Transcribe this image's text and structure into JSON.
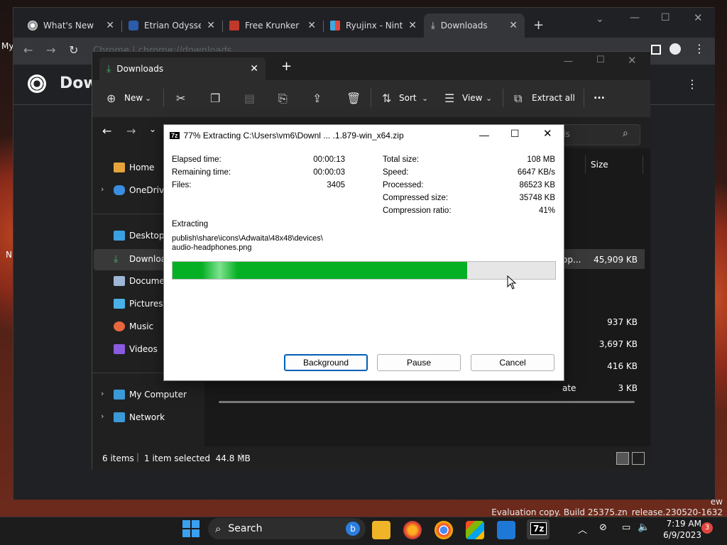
{
  "desktop": {
    "top_glyph": "My",
    "side_glyph_a": "N",
    "eval_line1": "ew",
    "eval_line2": "Evaluation copy. Build 25375.zn_release.230520-1632"
  },
  "chrome": {
    "tabs": [
      {
        "label": "What's New",
        "icon": "chrome-icon"
      },
      {
        "label": "Etrian Odyssey",
        "icon": "site-icon"
      },
      {
        "label": "Free Krunker A",
        "icon": "site-icon"
      },
      {
        "label": "Ryujinx - Ninte",
        "icon": "site-icon"
      },
      {
        "label": "Downloads",
        "icon": "download-icon"
      }
    ],
    "new_tab": "+",
    "omnibox_text": "Chrome | chrome://downloads",
    "page_title": "Downl"
  },
  "explorer": {
    "tab_label": "Downloads",
    "toolbar": {
      "new": "New",
      "sort": "Sort",
      "view": "View",
      "extract_all": "Extract all",
      "more": "..."
    },
    "search_placeholder": "ds",
    "column_size": "Size",
    "sidebar": [
      {
        "label": "Home"
      },
      {
        "label": "OneDrive"
      },
      {
        "label": "Desktop"
      },
      {
        "label": "Downloads"
      },
      {
        "label": "Documents"
      },
      {
        "label": "Pictures"
      },
      {
        "label": "Music"
      },
      {
        "label": "Videos"
      },
      {
        "label": "My Computer"
      },
      {
        "label": "Network"
      }
    ],
    "rows": [
      {
        "name": "op...",
        "size": "45,909 KB"
      },
      {
        "name": "",
        "size": "937 KB"
      },
      {
        "name": "",
        "size": "3,697 KB"
      },
      {
        "name": "",
        "size": "416 KB"
      },
      {
        "name": "ate",
        "size": "3 KB"
      }
    ],
    "status": {
      "items": "6 items",
      "selected": "1 item selected  44.8 MB"
    }
  },
  "zip": {
    "title": "77% Extracting C:\\Users\\vm6\\Downl ... .1.879-win_x64.zip",
    "progress_percent": 77,
    "left": [
      {
        "label": "Elapsed time:",
        "value": "00:00:13"
      },
      {
        "label": "Remaining time:",
        "value": "00:00:03"
      },
      {
        "label": "Files:",
        "value": "3405"
      }
    ],
    "right": [
      {
        "label": "Total size:",
        "value": "108 MB"
      },
      {
        "label": "Speed:",
        "value": "6647 KB/s"
      },
      {
        "label": "Processed:",
        "value": "86523 KB"
      },
      {
        "label": "Compressed size:",
        "value": "35748 KB"
      },
      {
        "label": "Compression ratio:",
        "value": "41%"
      }
    ],
    "extracting_label": "Extracting",
    "path_line1": "publish\\share\\icons\\Adwaita\\48x48\\devices\\",
    "path_line2": "audio-headphones.png",
    "buttons": {
      "background": "Background",
      "pause": "Pause",
      "cancel": "Cancel"
    }
  },
  "taskbar": {
    "search": "Search",
    "time": "7:19 AM",
    "date": "6/9/2023",
    "badge": "3"
  },
  "colors": {
    "progress_green": "#06b025",
    "taskbar": "#1c1c1c",
    "explorer_bg": "#202020"
  }
}
